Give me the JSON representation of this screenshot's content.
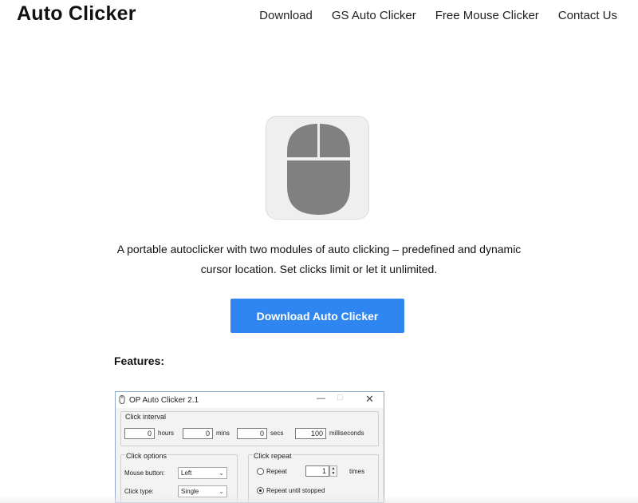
{
  "header": {
    "brand": "Auto Clicker",
    "nav": [
      "Download",
      "GS Auto Clicker",
      "Free Mouse Clicker",
      "Contact Us"
    ]
  },
  "hero": {
    "logo_icon": "computer-mouse-icon",
    "logo_color": "#808080",
    "tile_color": "#efefef",
    "description_line1": "A portable autoclicker with two modules of auto clicking – predefined and dynamic",
    "description_line2": "cursor location. Set clicks limit or let it unlimited.",
    "download_button": "Download Auto Clicker",
    "button_color": "#2f86f0"
  },
  "features_heading": "Features:",
  "app_screenshot": {
    "title": "OP Auto Clicker 2.1",
    "click_interval": {
      "label": "Click interval",
      "hours_value": "0",
      "hours_unit": "hours",
      "mins_value": "0",
      "mins_unit": "mins",
      "secs_value": "0",
      "secs_unit": "secs",
      "ms_value": "100",
      "ms_unit": "milliseconds"
    },
    "click_options": {
      "label": "Click options",
      "mouse_button_label": "Mouse button:",
      "mouse_button_value": "Left",
      "click_type_label": "Click type:",
      "click_type_value": "Single"
    },
    "click_repeat": {
      "label": "Click repeat",
      "repeat_label": "Repeat",
      "repeat_value": "1",
      "times_label": "times",
      "until_stopped_label": "Repeat until stopped"
    }
  }
}
